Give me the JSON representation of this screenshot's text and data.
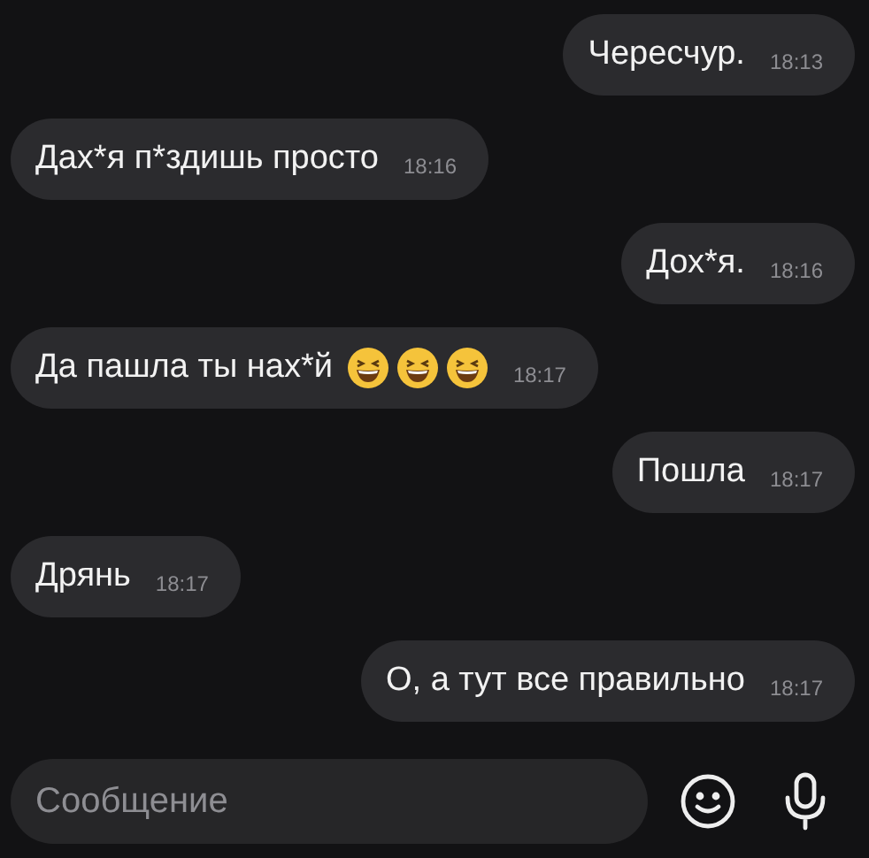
{
  "messages": [
    {
      "kind": "outgoing",
      "text": "Чересчур.",
      "time": "18:13"
    },
    {
      "kind": "incoming",
      "text": "Дах*я п*здишь просто",
      "time": "18:16"
    },
    {
      "kind": "outgoing",
      "text": "Дох*я.",
      "time": "18:16"
    },
    {
      "kind": "incoming",
      "text": "Да пашла ты нах*й",
      "emojis": [
        {
          "kind": "laughing"
        },
        {
          "kind": "laughing"
        },
        {
          "kind": "laughing"
        }
      ],
      "time": "18:17"
    },
    {
      "kind": "outgoing",
      "text": "Пошла",
      "time": "18:17"
    },
    {
      "kind": "incoming",
      "text": "Дрянь",
      "time": "18:17"
    },
    {
      "kind": "outgoing",
      "text": "О, а тут все правильно",
      "time": "18:17"
    }
  ],
  "composer": {
    "placeholder": "Сообщение"
  }
}
